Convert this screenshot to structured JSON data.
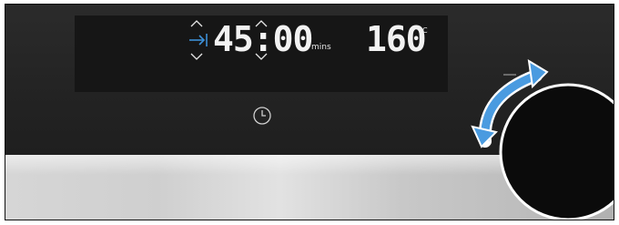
{
  "display": {
    "time_value": "45:00",
    "time_unit": "mins",
    "temperature_value": "160",
    "temperature_unit": "°C"
  },
  "colors": {
    "panel": "#262626",
    "display_window": "#161616",
    "digits": "#f2f2f2",
    "end_time_icon": "#3d8fd6",
    "rotate_arrow": "#4a9be0",
    "knob": "#0b0b0b"
  },
  "icons": [
    "up-arrow-icon",
    "down-arrow-icon",
    "end-time-icon",
    "clock-icon",
    "rotate-arrow-icon"
  ]
}
